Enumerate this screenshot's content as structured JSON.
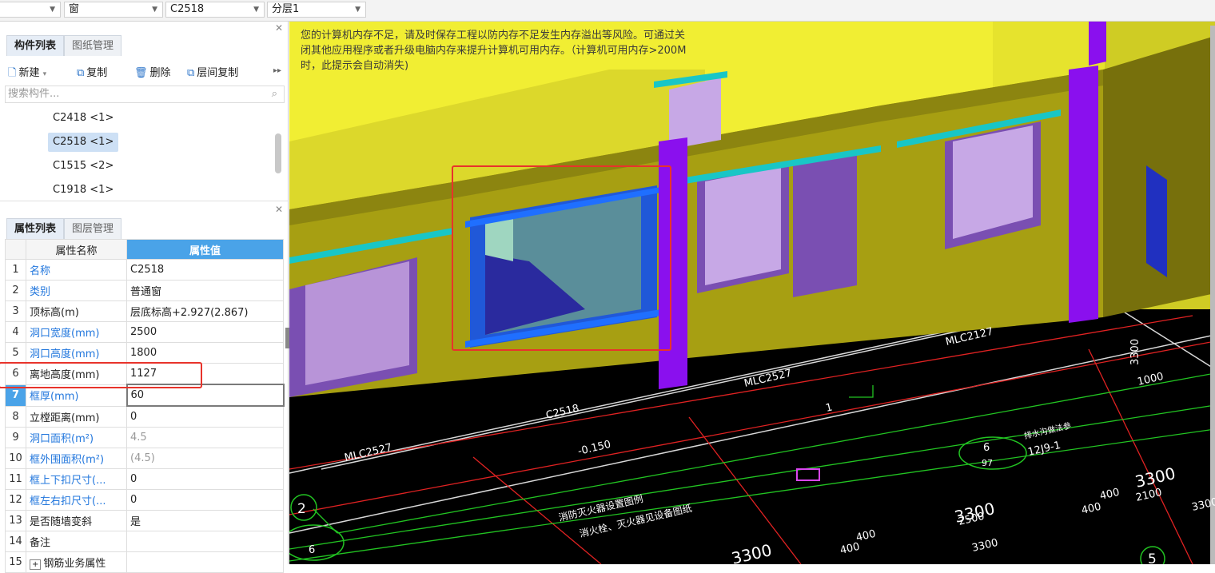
{
  "toolbar": {
    "combo1": "",
    "combo2": "窗",
    "combo3": "C2518",
    "combo4": "分层1"
  },
  "component_panel": {
    "tabs": [
      "构件列表",
      "图纸管理"
    ],
    "buttons": {
      "new": "新建",
      "copy": "复制",
      "delete": "删除",
      "floor_copy": "层间复制"
    },
    "search_placeholder": "搜索构件...",
    "items": [
      "C2418 <1>",
      "C2518 <1>",
      "C1515 <2>",
      "C1918 <1>"
    ]
  },
  "property_panel": {
    "tabs": [
      "属性列表",
      "图层管理"
    ],
    "headers": {
      "name": "属性名称",
      "value": "属性值"
    },
    "rows": [
      {
        "num": "1",
        "name": "名称",
        "value": "C2518"
      },
      {
        "num": "2",
        "name": "类别",
        "value": "普通窗"
      },
      {
        "num": "3",
        "name": "顶标高(m)",
        "value": "层底标高+2.927(2.867)"
      },
      {
        "num": "4",
        "name": "洞口宽度(mm)",
        "value": "2500"
      },
      {
        "num": "5",
        "name": "洞口高度(mm)",
        "value": "1800"
      },
      {
        "num": "6",
        "name": "离地高度(mm)",
        "value": "1127"
      },
      {
        "num": "7",
        "name": "框厚(mm)",
        "value": "60"
      },
      {
        "num": "8",
        "name": "立樘距离(mm)",
        "value": "0"
      },
      {
        "num": "9",
        "name": "洞口面积(m²)",
        "value": "4.5"
      },
      {
        "num": "10",
        "name": "框外围面积(m²)",
        "value": "(4.5)"
      },
      {
        "num": "11",
        "name": "框上下扣尺寸(...",
        "value": "0"
      },
      {
        "num": "12",
        "name": "框左右扣尺寸(...",
        "value": "0"
      },
      {
        "num": "13",
        "name": "是否随墙变斜",
        "value": "是"
      },
      {
        "num": "14",
        "name": "备注",
        "value": ""
      },
      {
        "num": "15",
        "name": "钢筋业务属性",
        "value": ""
      }
    ]
  },
  "viewport": {
    "notice": "您的计算机内存不足，请及时保存工程以防内存不足发生内存溢出等风险。可通过关闭其他应用程序或者升级电脑内存来提升计算机可用内存。（计算机可用内存>200M时，此提示会自动消失)",
    "cad_labels": {
      "c2518": "C2518",
      "mlc2527_left": "MLC2527",
      "mlc2527_mid": "MLC2527",
      "mlc2127": "MLC2127",
      "elev": "-0.150",
      "one": "1",
      "dim_1000": "1000",
      "dim_3300_a": "3300",
      "dim_3300_b": "3300",
      "dim_3300_c": "3300",
      "dim_3300_d": "3300",
      "dim_2500": "2500",
      "dim_3300_e": "3300",
      "dim_400_a": "400",
      "dim_400_b": "400",
      "dim_400_c": "400",
      "dim_400_d": "400",
      "dim_2100": "2100",
      "circle_6": "6",
      "circle_97": "97",
      "circle_2": "2",
      "circle_6b": "6",
      "circle_5": "5",
      "ref_1209": "12J9-1",
      "ref_note": "排水沟做法参",
      "fire_note1": "消防灭火器设置图例",
      "fire_note2": "消火栓、灭火器见设备图纸",
      "dim_3300_side": "3300"
    }
  }
}
